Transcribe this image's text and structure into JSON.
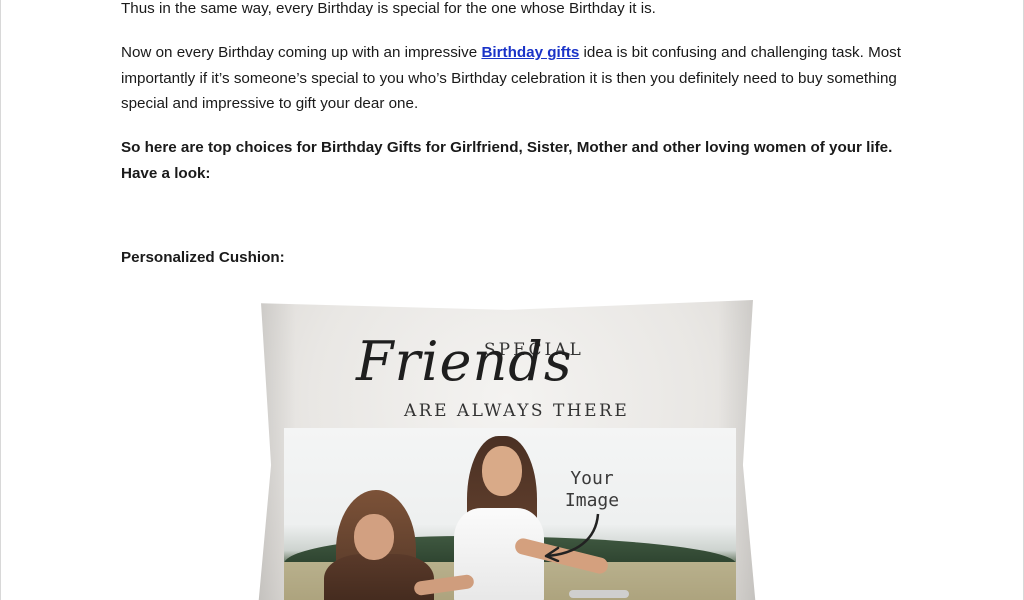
{
  "document": {
    "para1": "Thus in the same way, every Birthday is special for the one whose Birthday it is.",
    "para2_before": "Now on every Birthday coming up with an impressive ",
    "para2_link": "Birthday gifts",
    "para2_after": " idea is bit confusing and challenging task. Most importantly if it’s someone’s special to you who’s Birthday celebration it is then you definitely need to buy something special and impressive to gift your dear one.",
    "para3": "So here are top choices for Birthday Gifts for Girlfriend, Sister, Mother and other loving women of your life. Have a look:",
    "heading": "Personalized Cushion:"
  },
  "cushion": {
    "text_special": "SPECIAL",
    "text_friends": "Friends",
    "text_always": "ARE ALWAYS THERE",
    "placeholder_line1": "Your",
    "placeholder_line2": "Image"
  },
  "colors": {
    "link": "#1a33c8",
    "text": "#1a1a1a"
  }
}
